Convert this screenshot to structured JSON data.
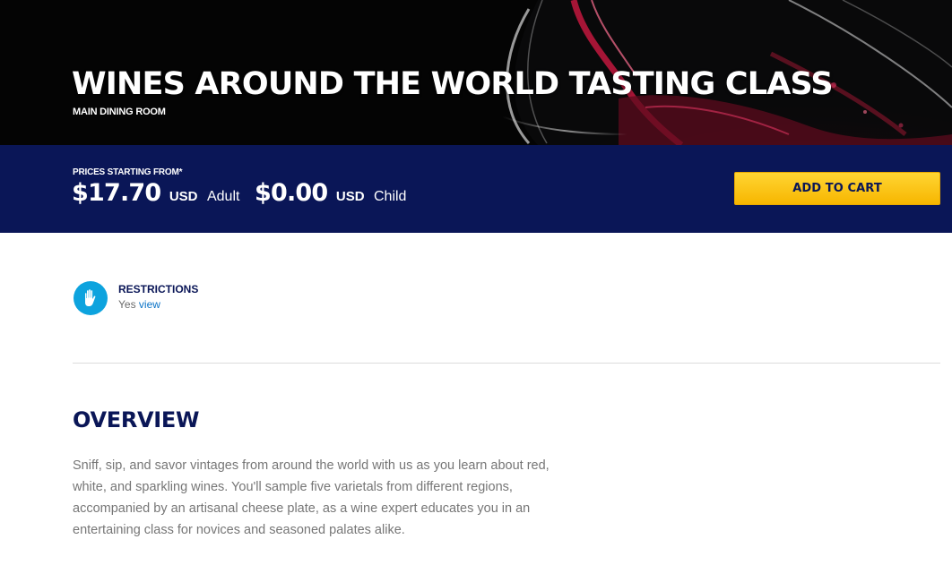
{
  "hero": {
    "title": "WINES AROUND THE WORLD TASTING CLASS",
    "subtitle": "MAIN DINING ROOM"
  },
  "pricing": {
    "label": "PRICES STARTING FROM*",
    "adult": {
      "amount": "$17.70",
      "currency": "USD",
      "type": "Adult"
    },
    "child": {
      "amount": "$0.00",
      "currency": "USD",
      "type": "Child"
    },
    "cart_button": "ADD TO CART"
  },
  "restrictions": {
    "title": "RESTRICTIONS",
    "value": "Yes",
    "link": "view",
    "icon": "hand-stop-icon"
  },
  "overview": {
    "title": "OVERVIEW",
    "description": "Sniff, sip, and savor vintages from around the world with us as you learn about red, white, and sparkling wines. You'll sample five varietals from different regions, accompanied by an artisanal cheese plate, as a wine expert educates you in an entertaining class for novices and seasoned palates alike."
  },
  "colors": {
    "navy": "#0a1657",
    "gold": "#f7b600",
    "icon_blue": "#0da3de",
    "link_blue": "#0a73c7",
    "body_text": "#767676"
  }
}
